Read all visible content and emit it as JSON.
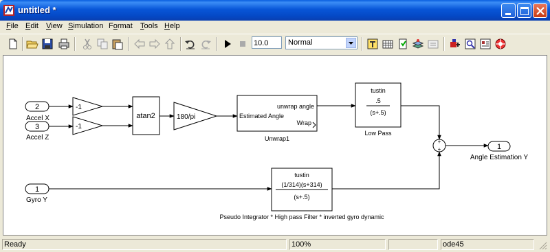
{
  "window": {
    "title": "untitled *"
  },
  "menu": [
    "File",
    "Edit",
    "View",
    "Simulation",
    "Format",
    "Tools",
    "Help"
  ],
  "menu_access_keys": [
    "F",
    "E",
    "V",
    "S",
    "o",
    "T",
    "H"
  ],
  "toolbar": {
    "stop_time": "10.0",
    "sim_mode": "Normal",
    "icons": [
      "new-icon",
      "open-icon",
      "save-icon",
      "print-icon",
      "cut-icon",
      "copy-icon",
      "paste-icon",
      "back-icon",
      "forward-icon",
      "up-icon",
      "undo-icon",
      "redo-icon",
      "start-icon",
      "stop-icon",
      "build-icon",
      "update-icon",
      "explorer-icon",
      "library-browser-icon",
      "model-explorer-icon",
      "debugger-icon",
      "accel-icon",
      "profiler-icon"
    ]
  },
  "diagram": {
    "inport_accel_x": {
      "number": "2",
      "label": "Accel X"
    },
    "inport_accel_z": {
      "number": "3",
      "label": "Accel Z"
    },
    "inport_gyro_y": {
      "number": "1",
      "label": "Gyro Y"
    },
    "gain_x": "-1",
    "gain_z": "-1",
    "atan2": "atan2",
    "gain_deg": "180/pi",
    "unwrap": {
      "in_port": "Estimated Angle",
      "out_port1": "unwrap angle",
      "out_port2": "Wrap",
      "name": "Unwrap1"
    },
    "low_pass": {
      "method": "tustin",
      "num": ".5",
      "den": "(s+.5)",
      "name": "Low Pass"
    },
    "sum": {
      "sign1": "+",
      "sign2": "+"
    },
    "outport": {
      "number": "1",
      "label": "Angle Estimation Y"
    },
    "pseudo": {
      "method": "tustin",
      "num": "(1/314)(s+314)",
      "den": "(s+.5)",
      "name": "Pseudo Integrator * High pass Filter * inverted gyro dynamic"
    }
  },
  "status": {
    "left": "Ready",
    "zoom": "100%",
    "solver": "ode45"
  },
  "colors": {
    "title_blue": "#0856d8",
    "canvas": "#ffffff",
    "chrome": "#ece9d8"
  }
}
